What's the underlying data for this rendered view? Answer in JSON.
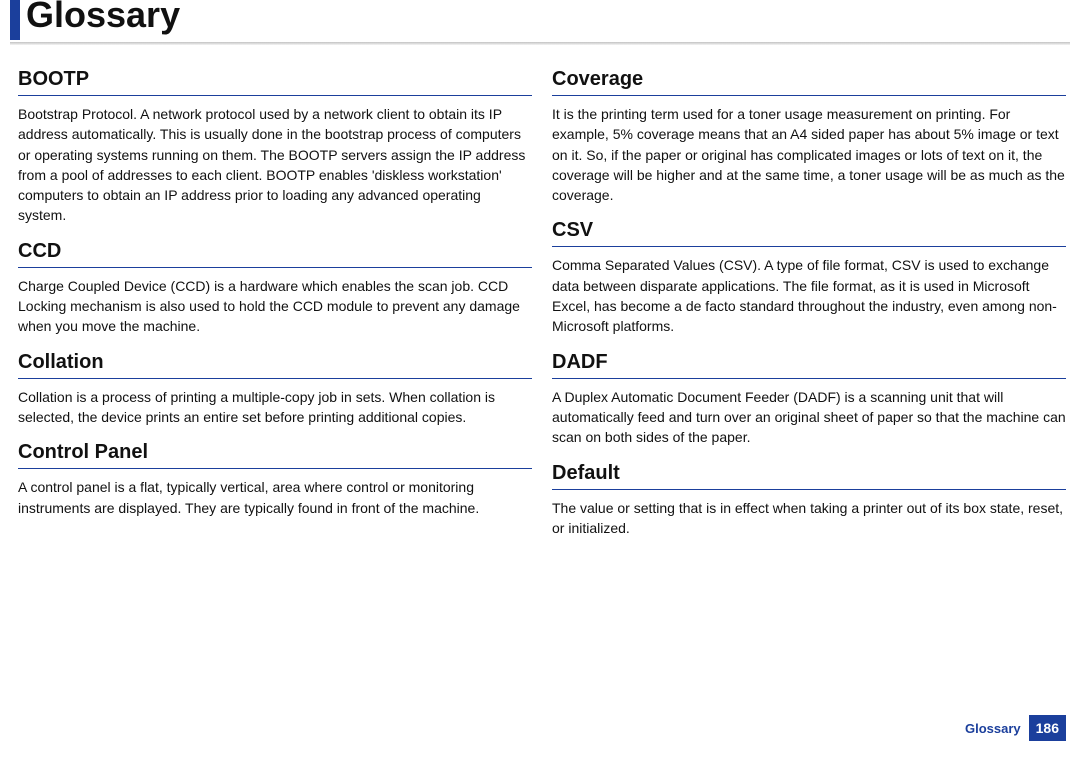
{
  "header": {
    "title": "Glossary"
  },
  "columns": [
    [
      {
        "term": "BOOTP",
        "definition": "Bootstrap Protocol. A network protocol used by a network client to obtain its IP address automatically. This is usually done in the bootstrap process of computers or operating systems running on them. The BOOTP servers assign the IP address from a pool of addresses to each client. BOOTP enables 'diskless workstation' computers to obtain an IP address prior to loading any advanced operating system."
      },
      {
        "term": "CCD",
        "definition": "Charge Coupled Device (CCD) is a hardware which enables the scan job. CCD Locking mechanism is also used to hold the CCD module to prevent any damage when you move the machine."
      },
      {
        "term": "Collation",
        "definition": "Collation is a process of printing a multiple-copy job in sets. When collation is selected, the device prints an entire set before printing additional copies."
      },
      {
        "term": "Control Panel",
        "definition": "A control panel is a flat, typically vertical, area where control or monitoring instruments are displayed. They are typically found in front of the machine."
      }
    ],
    [
      {
        "term": "Coverage",
        "definition": "It is the printing term used for a toner usage measurement on printing. For example, 5% coverage means that an A4 sided paper has about 5% image or text on it. So, if the paper or original has complicated images or lots of text on it, the coverage will be higher and at the same time, a toner usage will be as much as the coverage."
      },
      {
        "term": "CSV",
        "definition": "Comma Separated Values (CSV). A type of file format, CSV is used to exchange data between disparate applications. The file format, as it is used in Microsoft Excel, has become a de facto standard throughout the industry, even among non-Microsoft platforms."
      },
      {
        "term": "DADF",
        "definition": "A Duplex Automatic Document Feeder (DADF) is a scanning unit that will automatically feed and turn over an original sheet of paper so that the machine can scan on both sides of the paper."
      },
      {
        "term": "Default",
        "definition": "The value or setting that is in effect when taking a printer out of its box state, reset, or initialized."
      }
    ]
  ],
  "footer": {
    "label": "Glossary",
    "page_number": "186"
  }
}
